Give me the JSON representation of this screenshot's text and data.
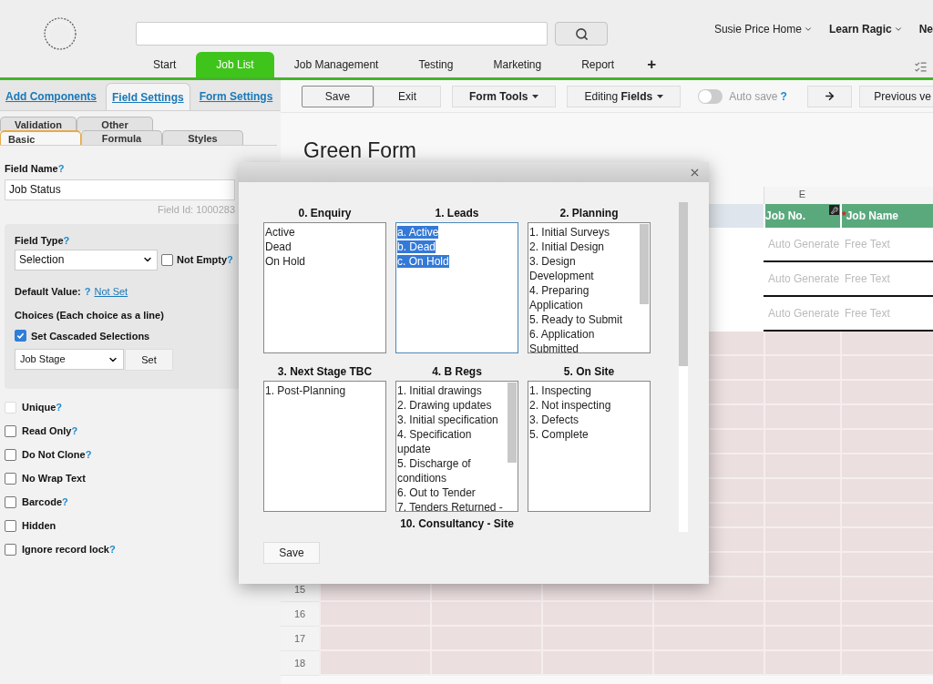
{
  "header": {
    "user_menus": [
      {
        "label": "Susie Price Home",
        "bold": false,
        "caret": true
      },
      {
        "label": "Learn Ragic",
        "bold": true,
        "caret": true
      },
      {
        "label": "Ne",
        "bold": true,
        "caret": false
      }
    ]
  },
  "nav_tabs": [
    {
      "kind": "tab",
      "label": "Start",
      "selected": false
    },
    {
      "kind": "tab",
      "label": "Job List",
      "selected": true
    },
    {
      "kind": "tab",
      "label": "Job Management",
      "selected": false
    },
    {
      "kind": "tab",
      "label": "Testing",
      "selected": false
    },
    {
      "kind": "tab",
      "label": "Marketing",
      "selected": false
    },
    {
      "kind": "tab",
      "label": "Report",
      "selected": false
    },
    {
      "kind": "add",
      "label": "+",
      "selected": false
    }
  ],
  "left_panel": {
    "tabs": [
      {
        "label": "Add Components",
        "selected": false
      },
      {
        "label": "Field Settings",
        "selected": true
      },
      {
        "label": "Form Settings",
        "selected": false
      }
    ],
    "sub_tab_rows": [
      [
        {
          "label": "Validation",
          "selected": false
        },
        {
          "label": "Other",
          "selected": false
        }
      ],
      [
        {
          "label": "Basic",
          "selected": true
        },
        {
          "label": "Formula",
          "selected": false
        },
        {
          "label": "Styles",
          "selected": false
        }
      ]
    ],
    "field_name": {
      "label": "Field Name",
      "help": "?",
      "value": "Job Status",
      "field_id": "Field Id: 1000283"
    },
    "field_type": {
      "label": "Field Type",
      "help": "?",
      "value": "Selection"
    },
    "not_empty": {
      "label": "Not Empty",
      "help": "?",
      "checked": false
    },
    "default_value": {
      "label": "Default Value:",
      "help": "?",
      "link": "Not Set"
    },
    "choices_label": "Choices (Each choice as a line)",
    "cascaded": {
      "label": "Set Cascaded Selections",
      "checked": true
    },
    "cascade_field": {
      "value": "Job Stage",
      "button": "Set"
    },
    "options": [
      {
        "label": "Unique",
        "help": "?",
        "checked": false,
        "disabled": true
      },
      {
        "label": "Read Only",
        "help": "?",
        "checked": false,
        "disabled": false
      },
      {
        "label": "Do Not Clone",
        "help": "?",
        "checked": false,
        "disabled": false
      },
      {
        "label": "No Wrap Text",
        "checked": false,
        "disabled": false
      },
      {
        "label": "Barcode",
        "help": "?",
        "checked": false,
        "disabled": false
      },
      {
        "label": "Hidden",
        "checked": false,
        "disabled": false
      },
      {
        "label": "Ignore record lock",
        "help": "?",
        "checked": false,
        "disabled": false
      }
    ]
  },
  "toolbar": {
    "buttons": [
      {
        "kind": "plain",
        "label": "Save",
        "focused": true
      },
      {
        "kind": "plain",
        "label": "Exit",
        "focused": false
      },
      {
        "kind": "dropdown",
        "label": "**Form Tools**",
        "focused": false
      },
      {
        "kind": "dropdown",
        "label": "Editing **Fields**",
        "focused": false
      }
    ],
    "auto_save": {
      "label": "Auto save",
      "help": "?",
      "on": false
    },
    "right_buttons": [
      {
        "kind": "arrow"
      },
      {
        "kind": "plain",
        "label": "Previous ve"
      }
    ]
  },
  "form_title": "Green Form",
  "grid": {
    "column_letter": "E",
    "headers": [
      {
        "label": "Job No.",
        "locked": true
      },
      {
        "label": "Job Name",
        "required_mark": "*",
        "locked": false
      }
    ],
    "rows": [
      {
        "cells": [
          "Auto Generate",
          "Free Text"
        ]
      },
      {
        "cells": [
          "Auto Generate",
          "Free Text"
        ]
      },
      {
        "cells": [
          "Auto Generate",
          "Free Text"
        ]
      }
    ],
    "row_numbers": [
      "15",
      "16",
      "17",
      "18"
    ]
  },
  "modal": {
    "sections": [
      {
        "title": "0. Enquiry",
        "lines": [
          "Active",
          "Dead",
          "On Hold"
        ],
        "text_selected": false,
        "scrollbar": false
      },
      {
        "title": "1. Leads",
        "lines": [
          "a. Active",
          "b. Dead",
          "c. On Hold"
        ],
        "text_selected": true,
        "scrollbar": false
      },
      {
        "title": "2. Planning",
        "lines": [
          "1. Initial Surveys",
          "2. Initial Design",
          "3. Design Development",
          "4. Preparing Application",
          "5. Ready to Submit",
          "6. Application Submitted"
        ],
        "text_selected": false,
        "scrollbar": true
      },
      {
        "title": "3. Next Stage TBC",
        "lines": [
          "1. Post-Planning"
        ],
        "text_selected": false,
        "scrollbar": false
      },
      {
        "title": "4. B Regs",
        "lines": [
          "1. Initial drawings",
          "2. Drawing updates",
          "3. Initial specification",
          "4. Specification update",
          "5. Discharge of conditions",
          "6. Out to Tender",
          "7. Tenders Returned -"
        ],
        "text_selected": false,
        "scrollbar": true
      },
      {
        "title": "5. On Site",
        "lines": [
          "1. Inspecting",
          "2. Not inspecting",
          "3. Defects",
          "5. Complete"
        ],
        "text_selected": false,
        "scrollbar": false
      }
    ],
    "next_title": "10. Consultancy - Site",
    "save": "Save"
  }
}
